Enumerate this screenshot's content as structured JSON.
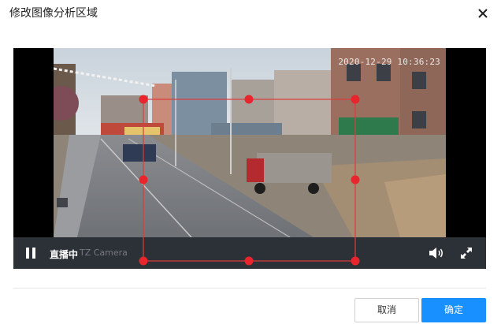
{
  "dialog": {
    "title": "修改图像分析区域",
    "close_icon": "close-icon"
  },
  "video": {
    "timestamp": "2020-12-29 10:36:23",
    "osd_text": "TZ Camera",
    "controls": {
      "pause_icon": "pause-icon",
      "live_label": "直播中",
      "volume_icon": "volume-icon",
      "fullscreen_icon": "fullscreen-icon"
    }
  },
  "colors": {
    "region_stroke": "#e03a3a",
    "handle_fill": "#e8242c",
    "primary": "#1890ff"
  },
  "footer": {
    "cancel_label": "取消",
    "ok_label": "确定"
  }
}
